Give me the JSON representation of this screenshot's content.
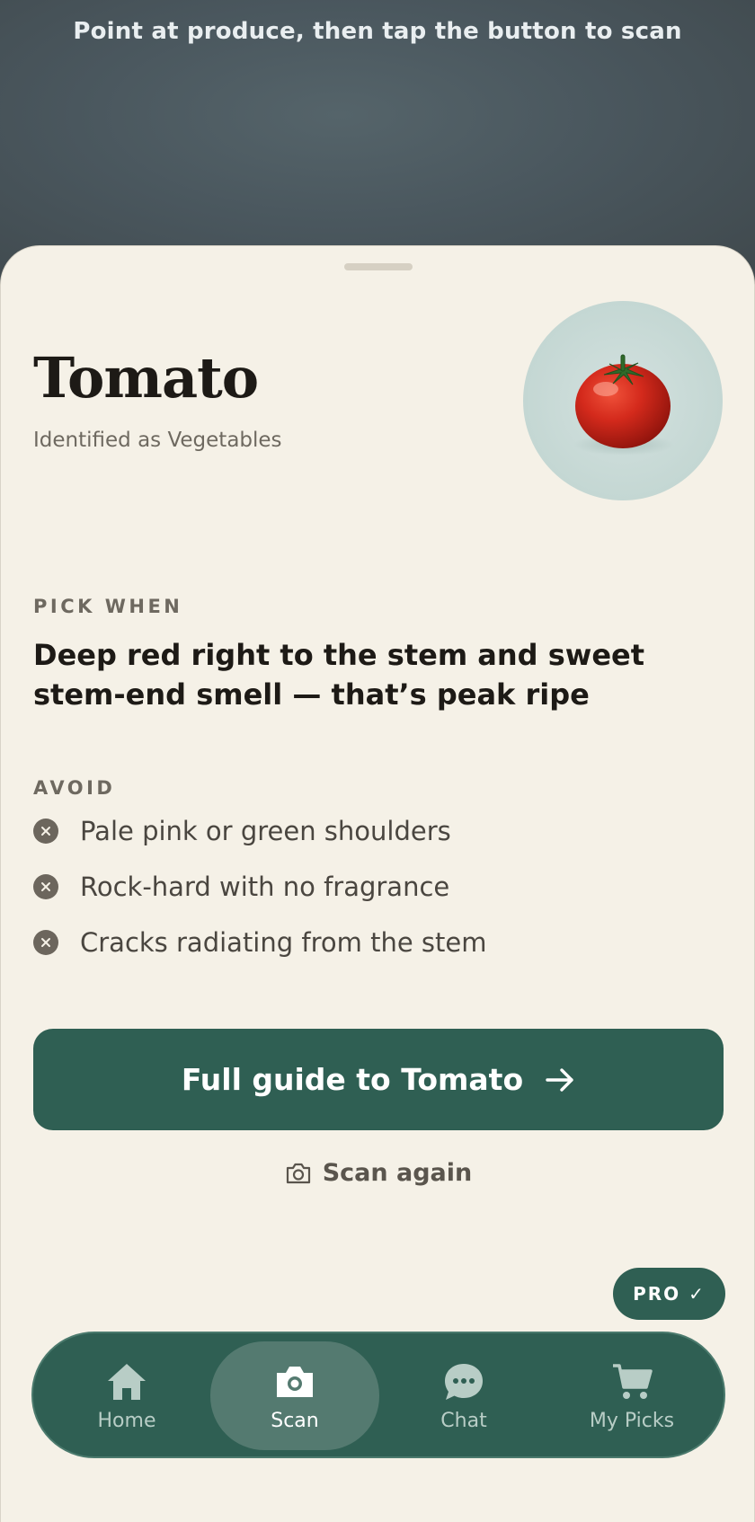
{
  "camera": {
    "hint": "Point at produce, then tap the button to scan"
  },
  "result": {
    "title": "Tomato",
    "subtitle": "Identified as Vegetables",
    "pick_label": "PICK WHEN",
    "pick_text": "Deep red right to the stem and sweet stem-end smell — that’s peak ripe",
    "avoid_label": "AVOID",
    "avoid_items": [
      "Pale pink or green shoulders",
      "Rock-hard with no fragrance",
      "Cracks radiating from the stem"
    ],
    "guide_button": "Full guide to Tomato",
    "scan_again": "Scan again"
  },
  "pro_badge": "PRO ✓",
  "nav": {
    "items": [
      {
        "label": "Home",
        "icon": "home-icon"
      },
      {
        "label": "Scan",
        "icon": "camera-icon",
        "active": true
      },
      {
        "label": "Chat",
        "icon": "chat-icon"
      },
      {
        "label": "My Picks",
        "icon": "cart-icon"
      }
    ]
  },
  "colors": {
    "accent": "#2f5f53",
    "sheet_bg": "#f5f1e7",
    "nav_active": "#547a70"
  }
}
